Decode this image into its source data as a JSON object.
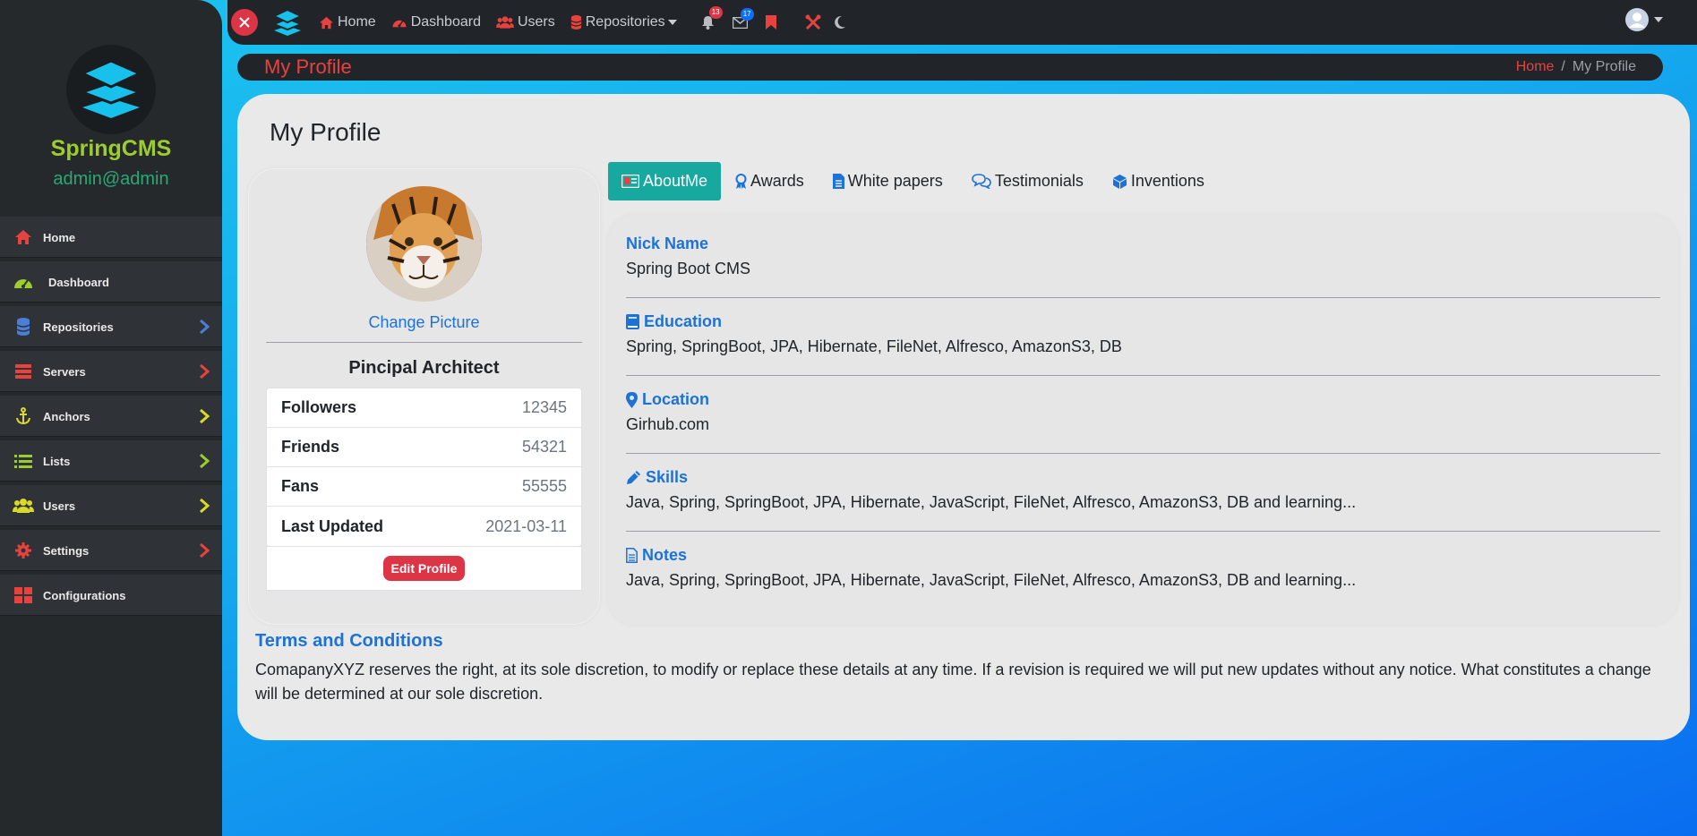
{
  "brand": {
    "name": "SpringCMS",
    "email": "admin@admin"
  },
  "sidebar": {
    "items": [
      {
        "label": "Home",
        "icon": "home-icon",
        "color": "#e8423e",
        "chevron": ""
      },
      {
        "label": "Dashboard",
        "icon": "dashboard-icon",
        "color": "#9ccc2f",
        "chevron": ""
      },
      {
        "label": "Repositories",
        "icon": "database-icon",
        "color": "#4a7ed8",
        "chevron": "#4a7ed8"
      },
      {
        "label": "Servers",
        "icon": "server-icon",
        "color": "#e8423e",
        "chevron": "#e8423e"
      },
      {
        "label": "Anchors",
        "icon": "anchor-icon",
        "color": "#d9d92a",
        "chevron": "#d9d92a"
      },
      {
        "label": "Lists",
        "icon": "list-icon",
        "color": "#9ccc2f",
        "chevron": "#9ccc2f"
      },
      {
        "label": "Users",
        "icon": "users-icon",
        "color": "#d9d92a",
        "chevron": "#d9d92a"
      },
      {
        "label": "Settings",
        "icon": "gear-icon",
        "color": "#e8423e",
        "chevron": "#e8423e"
      },
      {
        "label": "Configurations",
        "icon": "grid-icon",
        "color": "#e8423e",
        "chevron": ""
      }
    ]
  },
  "topbar": {
    "nav": [
      {
        "label": "Home",
        "icon": "home-icon"
      },
      {
        "label": "Dashboard",
        "icon": "dashboard-icon"
      },
      {
        "label": "Users",
        "icon": "users-icon"
      },
      {
        "label": "Repositories",
        "icon": "database-icon"
      }
    ],
    "notifications_count": "13",
    "messages_count": "17"
  },
  "page": {
    "header_title": "My Profile",
    "breadcrumb": {
      "home": "Home",
      "separator": "/",
      "current": "My Profile"
    },
    "title": "My Profile"
  },
  "profile": {
    "change_picture": "Change Picture",
    "role": "Pincipal Architect",
    "stats": [
      {
        "label": "Followers",
        "value": "12345"
      },
      {
        "label": "Friends",
        "value": "54321"
      },
      {
        "label": "Fans",
        "value": "55555"
      },
      {
        "label": "Last Updated",
        "value": "2021-03-11"
      }
    ],
    "edit_button": "Edit Profile"
  },
  "tabs": [
    {
      "label": "AboutMe",
      "icon": "id-card-icon",
      "active": true
    },
    {
      "label": "Awards",
      "icon": "award-icon",
      "active": false
    },
    {
      "label": "White papers",
      "icon": "file-icon",
      "active": false
    },
    {
      "label": "Testimonials",
      "icon": "comments-icon",
      "active": false
    },
    {
      "label": "Inventions",
      "icon": "cube-icon",
      "active": false
    }
  ],
  "about": {
    "fields": [
      {
        "label": "Nick Name",
        "value": "Spring Boot CMS"
      },
      {
        "label": "Education",
        "value": "Spring, SpringBoot, JPA, Hibernate, FileNet, Alfresco, AmazonS3, DB"
      },
      {
        "label": "Location",
        "value": "Girhub.com"
      },
      {
        "label": "Skills",
        "value": "Java, Spring, SpringBoot, JPA, Hibernate, JavaScript, FileNet, Alfresco, AmazonS3, DB and learning..."
      },
      {
        "label": "Notes",
        "value": "Java, Spring, SpringBoot, JPA, Hibernate, JavaScript, FileNet, Alfresco, AmazonS3, DB and learning..."
      }
    ]
  },
  "terms": {
    "title": "Terms and Conditions",
    "text": "ComapanyXYZ reserves the right, at its sole discretion, to modify or replace these details at any time. If a revision is required we will put new updates without any notice. What constitutes a change will be determined at our sole discretion."
  },
  "colors": {
    "accent_red": "#dc3545",
    "link_blue": "#1d72d6",
    "tab_active": "#17a9a0",
    "brand_green": "#9ccc2f"
  }
}
